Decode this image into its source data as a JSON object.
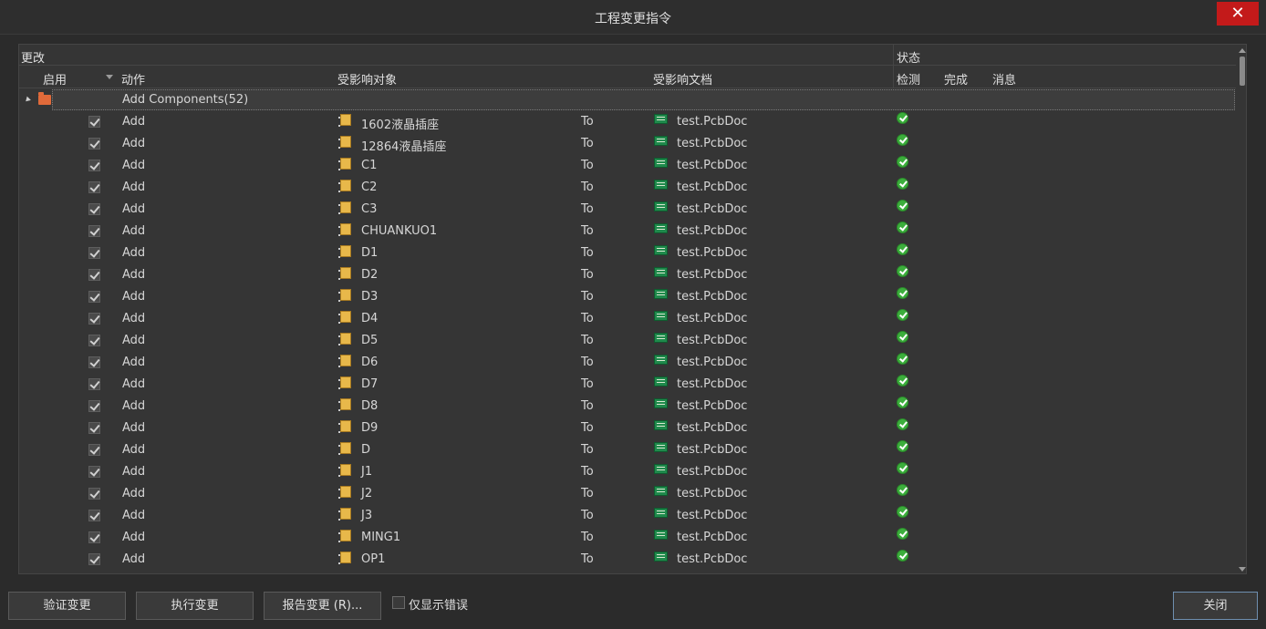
{
  "window": {
    "title": "工程变更指令",
    "close_glyph": "✕"
  },
  "table": {
    "group_headers": {
      "changes": "更改",
      "status": "状态"
    },
    "columns": {
      "enable": "启用",
      "action": "动作",
      "affected_object": "受影响对象",
      "affected_document": "受影响文档",
      "check": "检测",
      "done": "完成",
      "message": "消息"
    },
    "group_row": {
      "label": "Add Components(52)",
      "expanded": true
    },
    "rows": [
      {
        "enabled": true,
        "action": "Add",
        "object": "1602液晶插座",
        "to": "To",
        "document": "test.PcbDoc",
        "check": "ok"
      },
      {
        "enabled": true,
        "action": "Add",
        "object": "12864液晶插座",
        "to": "To",
        "document": "test.PcbDoc",
        "check": "ok"
      },
      {
        "enabled": true,
        "action": "Add",
        "object": "C1",
        "to": "To",
        "document": "test.PcbDoc",
        "check": "ok"
      },
      {
        "enabled": true,
        "action": "Add",
        "object": "C2",
        "to": "To",
        "document": "test.PcbDoc",
        "check": "ok"
      },
      {
        "enabled": true,
        "action": "Add",
        "object": "C3",
        "to": "To",
        "document": "test.PcbDoc",
        "check": "ok"
      },
      {
        "enabled": true,
        "action": "Add",
        "object": "CHUANKUO1",
        "to": "To",
        "document": "test.PcbDoc",
        "check": "ok"
      },
      {
        "enabled": true,
        "action": "Add",
        "object": "D1",
        "to": "To",
        "document": "test.PcbDoc",
        "check": "ok"
      },
      {
        "enabled": true,
        "action": "Add",
        "object": "D2",
        "to": "To",
        "document": "test.PcbDoc",
        "check": "ok"
      },
      {
        "enabled": true,
        "action": "Add",
        "object": "D3",
        "to": "To",
        "document": "test.PcbDoc",
        "check": "ok"
      },
      {
        "enabled": true,
        "action": "Add",
        "object": "D4",
        "to": "To",
        "document": "test.PcbDoc",
        "check": "ok"
      },
      {
        "enabled": true,
        "action": "Add",
        "object": "D5",
        "to": "To",
        "document": "test.PcbDoc",
        "check": "ok"
      },
      {
        "enabled": true,
        "action": "Add",
        "object": "D6",
        "to": "To",
        "document": "test.PcbDoc",
        "check": "ok"
      },
      {
        "enabled": true,
        "action": "Add",
        "object": "D7",
        "to": "To",
        "document": "test.PcbDoc",
        "check": "ok"
      },
      {
        "enabled": true,
        "action": "Add",
        "object": "D8",
        "to": "To",
        "document": "test.PcbDoc",
        "check": "ok"
      },
      {
        "enabled": true,
        "action": "Add",
        "object": "D9",
        "to": "To",
        "document": "test.PcbDoc",
        "check": "ok"
      },
      {
        "enabled": true,
        "action": "Add",
        "object": "D",
        "to": "To",
        "document": "test.PcbDoc",
        "check": "ok"
      },
      {
        "enabled": true,
        "action": "Add",
        "object": "J1",
        "to": "To",
        "document": "test.PcbDoc",
        "check": "ok"
      },
      {
        "enabled": true,
        "action": "Add",
        "object": "J2",
        "to": "To",
        "document": "test.PcbDoc",
        "check": "ok"
      },
      {
        "enabled": true,
        "action": "Add",
        "object": "J3",
        "to": "To",
        "document": "test.PcbDoc",
        "check": "ok"
      },
      {
        "enabled": true,
        "action": "Add",
        "object": "MING1",
        "to": "To",
        "document": "test.PcbDoc",
        "check": "ok"
      },
      {
        "enabled": true,
        "action": "Add",
        "object": "OP1",
        "to": "To",
        "document": "test.PcbDoc",
        "check": "ok"
      }
    ]
  },
  "footer": {
    "validate_label": "验证变更",
    "execute_label": "执行变更",
    "report_label": "报告变更 (R)...",
    "only_errors_label": "仅显示错误",
    "only_errors_checked": false,
    "close_label": "关闭"
  },
  "icons": {
    "component": "component-icon",
    "pcb_document": "pcb-document-icon",
    "status_ok": "check-ok-icon",
    "folder": "folder-icon"
  },
  "colors": {
    "close_button": "#c31a1a",
    "status_ok": "#3cae3c",
    "folder": "#e06a3a"
  }
}
